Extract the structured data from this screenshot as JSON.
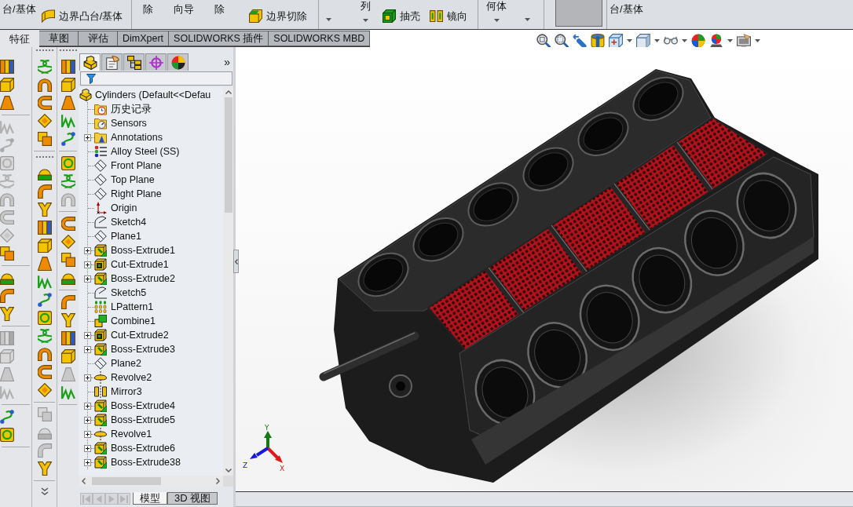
{
  "ribbon": {
    "groups": [
      {
        "items": [
          {
            "kind": "large",
            "label": "台/基体",
            "dropdown": false
          },
          {
            "kind": "small",
            "label": "边界凸台/基体"
          }
        ]
      },
      {
        "items": [
          {
            "kind": "large",
            "label": "除",
            "dropdown": false
          },
          {
            "kind": "large",
            "label": "向导",
            "dropdown": false
          },
          {
            "kind": "large",
            "label": "除",
            "dropdown": false
          },
          {
            "kind": "small",
            "label": "边界切除"
          }
        ]
      },
      {
        "items": [
          {
            "kind": "caret"
          },
          {
            "kind": "large",
            "label": "列",
            "dropdown": true
          },
          {
            "kind": "small",
            "label": "抽壳"
          },
          {
            "kind": "small",
            "label": "镜向"
          }
        ]
      },
      {
        "items": [
          {
            "kind": "large",
            "label": "何体",
            "dropdown": true
          },
          {
            "kind": "caret"
          }
        ]
      },
      {
        "items": [
          {
            "kind": "toggle",
            "on": true
          }
        ]
      },
      {
        "items": [
          {
            "kind": "large",
            "label": "台/基体",
            "dropdown": false
          }
        ]
      }
    ]
  },
  "command_tabs": [
    {
      "label": "特征",
      "selected": true
    },
    {
      "label": "草图",
      "selected": false
    },
    {
      "label": "评估",
      "selected": false
    },
    {
      "label": "DimXpert",
      "selected": false
    },
    {
      "label": "SOLIDWORKS 插件",
      "selected": false
    },
    {
      "label": "SOLIDWORKS MBD",
      "selected": false
    }
  ],
  "command_columns": [
    {
      "overflow": false,
      "groups": [
        {
          "grip": false,
          "buttons": [
            {
              "disabled": false
            },
            {
              "disabled": false
            },
            {
              "disabled": false
            }
          ]
        },
        {
          "grip": false,
          "buttons": [
            {
              "disabled": true
            },
            {
              "disabled": true
            },
            {
              "disabled": true
            },
            {
              "disabled": true
            },
            {
              "disabled": true
            },
            {
              "disabled": true
            },
            {
              "disabled": true
            },
            {
              "disabled": false
            }
          ]
        },
        {
          "grip": false,
          "buttons": [
            {
              "disabled": false
            },
            {
              "disabled": false
            },
            {
              "disabled": false
            }
          ]
        },
        {
          "grip": false,
          "buttons": [
            {
              "disabled": true
            },
            {
              "disabled": true
            },
            {
              "disabled": true
            },
            {
              "disabled": true
            }
          ]
        },
        {
          "grip": false,
          "buttons": [
            {
              "disabled": false
            },
            {
              "disabled": false
            }
          ]
        }
      ]
    },
    {
      "overflow": true,
      "groups": [
        {
          "grip": true,
          "buttons": [
            {
              "disabled": false
            },
            {
              "disabled": false
            },
            {
              "disabled": false
            },
            {
              "disabled": false
            },
            {
              "disabled": false
            }
          ]
        },
        {
          "grip": true,
          "buttons": [
            {
              "disabled": false
            },
            {
              "disabled": false
            },
            {
              "disabled": false
            },
            {
              "disabled": false
            },
            {
              "disabled": false
            },
            {
              "disabled": false
            },
            {
              "disabled": false
            },
            {
              "disabled": false
            },
            {
              "disabled": false
            },
            {
              "disabled": false
            },
            {
              "disabled": false
            },
            {
              "disabled": false
            },
            {
              "disabled": false
            }
          ]
        },
        {
          "grip": false,
          "buttons": [
            {
              "disabled": true
            },
            {
              "disabled": true
            },
            {
              "disabled": true
            },
            {
              "disabled": false
            }
          ]
        }
      ]
    },
    {
      "overflow": false,
      "groups": [
        {
          "grip": true,
          "buttons": [
            {
              "disabled": false
            },
            {
              "disabled": false
            },
            {
              "disabled": false
            },
            {
              "disabled": false
            },
            {
              "disabled": false
            }
          ]
        },
        {
          "grip": false,
          "buttons": [
            {
              "disabled": false
            },
            {
              "disabled": false
            },
            {
              "disabled": true
            }
          ]
        },
        {
          "grip": false,
          "buttons": [
            {
              "disabled": false
            },
            {
              "disabled": false
            },
            {
              "disabled": false
            },
            {
              "disabled": false
            }
          ]
        },
        {
          "grip": false,
          "buttons": [
            {
              "disabled": false
            },
            {
              "disabled": false
            },
            {
              "disabled": false
            },
            {
              "disabled": false
            },
            {
              "disabled": true
            },
            {
              "disabled": false
            }
          ]
        }
      ]
    }
  ],
  "feature_manager": {
    "tabs": [
      {
        "selected": true
      },
      {
        "selected": false
      },
      {
        "selected": false
      },
      {
        "selected": false
      },
      {
        "selected": false
      }
    ],
    "overflow": "»",
    "tree": {
      "label": "Cylinders (Default<<Defau",
      "kind": "part",
      "children": [
        {
          "label": "历史记录",
          "kind": "history",
          "collapsed": false
        },
        {
          "label": "Sensors",
          "kind": "sensors",
          "collapsed": false
        },
        {
          "label": "Annotations",
          "kind": "annotations",
          "collapsed": true
        },
        {
          "label": "Alloy Steel (SS)",
          "kind": "material",
          "collapsed": false
        },
        {
          "label": "Front Plane",
          "kind": "plane",
          "collapsed": false
        },
        {
          "label": "Top Plane",
          "kind": "plane",
          "collapsed": false
        },
        {
          "label": "Right Plane",
          "kind": "plane",
          "collapsed": false
        },
        {
          "label": "Origin",
          "kind": "origin",
          "collapsed": false
        },
        {
          "label": "Sketch4",
          "kind": "sketch",
          "collapsed": false
        },
        {
          "label": "Plane1",
          "kind": "plane",
          "collapsed": false
        },
        {
          "label": "Boss-Extrude1",
          "kind": "boss",
          "collapsed": true
        },
        {
          "label": "Cut-Extrude1",
          "kind": "cut",
          "collapsed": true
        },
        {
          "label": "Boss-Extrude2",
          "kind": "boss",
          "collapsed": true
        },
        {
          "label": "Sketch5",
          "kind": "sketch",
          "collapsed": false
        },
        {
          "label": "LPattern1",
          "kind": "pattern",
          "collapsed": false
        },
        {
          "label": "Combine1",
          "kind": "combine",
          "collapsed": false
        },
        {
          "label": "Cut-Extrude2",
          "kind": "cut",
          "collapsed": true
        },
        {
          "label": "Boss-Extrude3",
          "kind": "boss",
          "collapsed": true
        },
        {
          "label": "Plane2",
          "kind": "plane",
          "collapsed": false
        },
        {
          "label": "Revolve2",
          "kind": "revolve",
          "collapsed": true
        },
        {
          "label": "Mirror3",
          "kind": "mirror",
          "collapsed": false
        },
        {
          "label": "Boss-Extrude4",
          "kind": "boss",
          "collapsed": true
        },
        {
          "label": "Boss-Extrude5",
          "kind": "boss",
          "collapsed": true
        },
        {
          "label": "Revolve1",
          "kind": "revolve",
          "collapsed": true
        },
        {
          "label": "Boss-Extrude6",
          "kind": "boss",
          "collapsed": true
        },
        {
          "label": "Boss-Extrude38",
          "kind": "boss",
          "collapsed": true
        }
      ]
    },
    "scroll_buttons": [
      {
        "disabled": true
      },
      {
        "disabled": true
      },
      {
        "disabled": true
      },
      {
        "disabled": true
      }
    ],
    "bottom_tabs": [
      {
        "label": "模型",
        "selected": true
      },
      {
        "label": "3D 视图",
        "selected": false
      }
    ]
  },
  "graphics": {
    "triad": [
      {
        "kind": "y",
        "label": "Y",
        "color": "#127a12"
      },
      {
        "kind": "x",
        "label": "X",
        "color": "#e01818"
      },
      {
        "kind": "z",
        "label": "Z",
        "color": "#1818e0"
      }
    ]
  }
}
